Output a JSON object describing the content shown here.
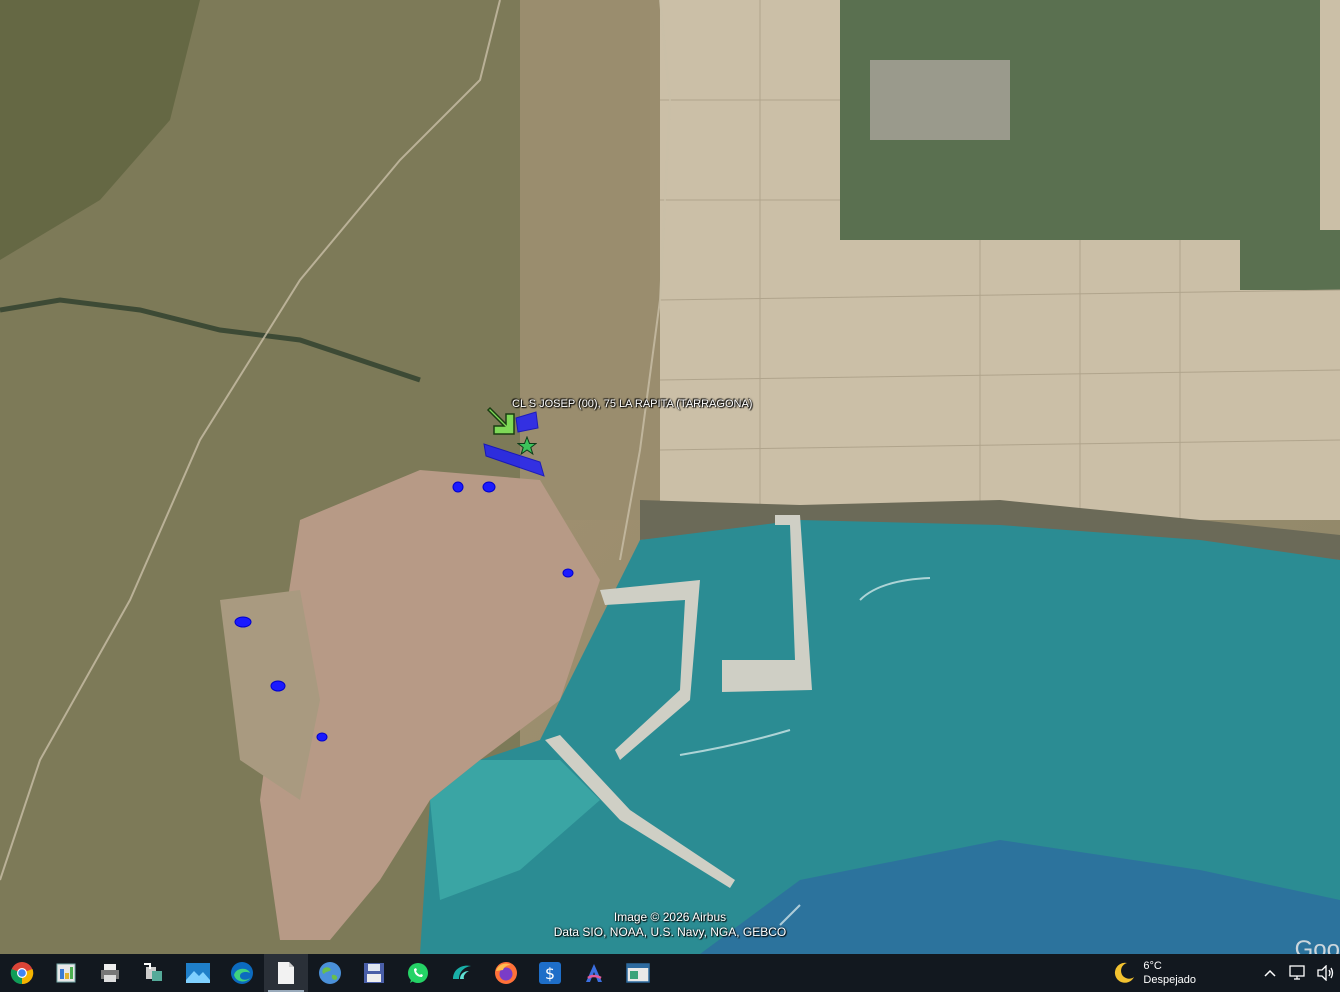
{
  "map": {
    "placemark_label": "CL S JOSEP (00), 75  LA RAPITA (TARRAGONA)",
    "attribution_line1": "Image © 2026 Airbus",
    "attribution_line2": "Data SIO, NOAA, U.S. Navy, NGA, GEBCO",
    "logo_text": "Goo",
    "colors": {
      "sea_deep": "#1f7a86",
      "sea_shallow": "#3aa5a4",
      "land": "#8b8565",
      "town": "#b79a86",
      "parcel": "#1a1aff",
      "arrow": "#7ed957"
    }
  },
  "taskbar": {
    "apps": [
      {
        "name": "chrome-icon"
      },
      {
        "name": "image-viewer-icon"
      },
      {
        "name": "printer-icon"
      },
      {
        "name": "network-share-icon"
      },
      {
        "name": "photos-icon"
      },
      {
        "name": "edge-icon"
      },
      {
        "name": "blank-document-icon"
      },
      {
        "name": "google-earth-icon"
      },
      {
        "name": "save-disk-icon"
      },
      {
        "name": "whatsapp-icon"
      },
      {
        "name": "wave-app-icon"
      },
      {
        "name": "firefox-icon"
      },
      {
        "name": "dollar-app-icon"
      },
      {
        "name": "arc-browser-icon"
      },
      {
        "name": "window-app-icon"
      }
    ],
    "weather": {
      "temperature": "6°C",
      "condition": "Despejado"
    }
  }
}
